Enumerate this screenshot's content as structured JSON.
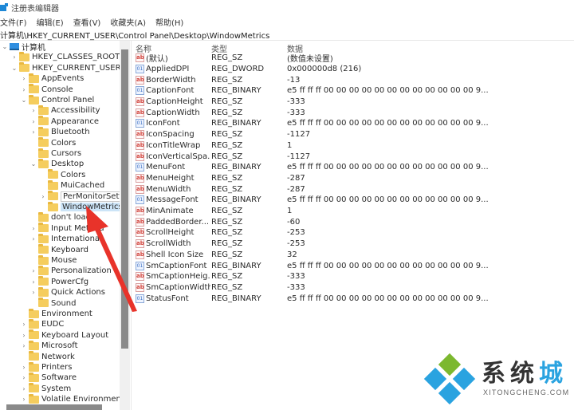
{
  "window": {
    "title": "注册表编辑器",
    "icon": "regedit-icon"
  },
  "menu": [
    "文件(F)",
    "编辑(E)",
    "查看(V)",
    "收藏夹(A)",
    "帮助(H)"
  ],
  "address": "计算机\\HKEY_CURRENT_USER\\Control Panel\\Desktop\\WindowMetrics",
  "tree": [
    {
      "label": "计算机",
      "depth": 0,
      "chevron": "down",
      "icon": "computer-icon"
    },
    {
      "label": "HKEY_CLASSES_ROOT",
      "depth": 1,
      "chevron": "right",
      "icon": "folder-icon"
    },
    {
      "label": "HKEY_CURRENT_USER",
      "depth": 1,
      "chevron": "down",
      "icon": "folder-icon"
    },
    {
      "label": "AppEvents",
      "depth": 2,
      "chevron": "right",
      "icon": "folder-icon"
    },
    {
      "label": "Console",
      "depth": 2,
      "chevron": "right",
      "icon": "folder-icon"
    },
    {
      "label": "Control Panel",
      "depth": 2,
      "chevron": "down",
      "icon": "folder-icon"
    },
    {
      "label": "Accessibility",
      "depth": 3,
      "chevron": "right",
      "icon": "folder-icon"
    },
    {
      "label": "Appearance",
      "depth": 3,
      "chevron": "right",
      "icon": "folder-icon"
    },
    {
      "label": "Bluetooth",
      "depth": 3,
      "chevron": "right",
      "icon": "folder-icon"
    },
    {
      "label": "Colors",
      "depth": 3,
      "chevron": "",
      "icon": "folder-icon"
    },
    {
      "label": "Cursors",
      "depth": 3,
      "chevron": "",
      "icon": "folder-icon"
    },
    {
      "label": "Desktop",
      "depth": 3,
      "chevron": "down",
      "icon": "folder-icon"
    },
    {
      "label": "Colors",
      "depth": 4,
      "chevron": "",
      "icon": "folder-icon"
    },
    {
      "label": "MuiCached",
      "depth": 4,
      "chevron": "",
      "icon": "folder-icon"
    },
    {
      "label": "PerMonitorSettings",
      "depth": 4,
      "chevron": "right",
      "icon": "folder-icon",
      "tooltip": true
    },
    {
      "label": "WindowMetrics",
      "depth": 4,
      "chevron": "",
      "icon": "folder-icon",
      "selected": true
    },
    {
      "label": "don't load",
      "depth": 3,
      "chevron": "",
      "icon": "folder-icon"
    },
    {
      "label": "Input Method",
      "depth": 3,
      "chevron": "right",
      "icon": "folder-icon"
    },
    {
      "label": "International",
      "depth": 3,
      "chevron": "right",
      "icon": "folder-icon"
    },
    {
      "label": "Keyboard",
      "depth": 3,
      "chevron": "",
      "icon": "folder-icon"
    },
    {
      "label": "Mouse",
      "depth": 3,
      "chevron": "",
      "icon": "folder-icon"
    },
    {
      "label": "Personalization",
      "depth": 3,
      "chevron": "right",
      "icon": "folder-icon"
    },
    {
      "label": "PowerCfg",
      "depth": 3,
      "chevron": "right",
      "icon": "folder-icon"
    },
    {
      "label": "Quick Actions",
      "depth": 3,
      "chevron": "right",
      "icon": "folder-icon"
    },
    {
      "label": "Sound",
      "depth": 3,
      "chevron": "",
      "icon": "folder-icon"
    },
    {
      "label": "Environment",
      "depth": 2,
      "chevron": "",
      "icon": "folder-icon"
    },
    {
      "label": "EUDC",
      "depth": 2,
      "chevron": "right",
      "icon": "folder-icon"
    },
    {
      "label": "Keyboard Layout",
      "depth": 2,
      "chevron": "right",
      "icon": "folder-icon"
    },
    {
      "label": "Microsoft",
      "depth": 2,
      "chevron": "right",
      "icon": "folder-icon"
    },
    {
      "label": "Network",
      "depth": 2,
      "chevron": "",
      "icon": "folder-icon"
    },
    {
      "label": "Printers",
      "depth": 2,
      "chevron": "right",
      "icon": "folder-icon"
    },
    {
      "label": "Software",
      "depth": 2,
      "chevron": "right",
      "icon": "folder-icon"
    },
    {
      "label": "System",
      "depth": 2,
      "chevron": "right",
      "icon": "folder-icon"
    },
    {
      "label": "Volatile Environment",
      "depth": 2,
      "chevron": "right",
      "icon": "folder-icon"
    }
  ],
  "list": {
    "headers": {
      "name": "名称",
      "type": "类型",
      "data": "数据"
    },
    "rows": [
      {
        "name": "(默认)",
        "type": "REG_SZ",
        "data": "(数值未设置)",
        "icon": "string-value-icon"
      },
      {
        "name": "AppliedDPI",
        "type": "REG_DWORD",
        "data": "0x000000d8 (216)",
        "icon": "binary-value-icon"
      },
      {
        "name": "BorderWidth",
        "type": "REG_SZ",
        "data": "-13",
        "icon": "string-value-icon"
      },
      {
        "name": "CaptionFont",
        "type": "REG_BINARY",
        "data": "e5 ff ff ff 00 00 00 00 00 00 00 00 00 00 00 00 9...",
        "icon": "binary-value-icon"
      },
      {
        "name": "CaptionHeight",
        "type": "REG_SZ",
        "data": "-333",
        "icon": "string-value-icon"
      },
      {
        "name": "CaptionWidth",
        "type": "REG_SZ",
        "data": "-333",
        "icon": "string-value-icon"
      },
      {
        "name": "IconFont",
        "type": "REG_BINARY",
        "data": "e5 ff ff ff 00 00 00 00 00 00 00 00 00 00 00 00 9...",
        "icon": "binary-value-icon"
      },
      {
        "name": "IconSpacing",
        "type": "REG_SZ",
        "data": "-1127",
        "icon": "string-value-icon"
      },
      {
        "name": "IconTitleWrap",
        "type": "REG_SZ",
        "data": "1",
        "icon": "string-value-icon"
      },
      {
        "name": "IconVerticalSpa...",
        "type": "REG_SZ",
        "data": "-1127",
        "icon": "string-value-icon"
      },
      {
        "name": "MenuFont",
        "type": "REG_BINARY",
        "data": "e5 ff ff ff 00 00 00 00 00 00 00 00 00 00 00 00 9...",
        "icon": "binary-value-icon"
      },
      {
        "name": "MenuHeight",
        "type": "REG_SZ",
        "data": "-287",
        "icon": "string-value-icon"
      },
      {
        "name": "MenuWidth",
        "type": "REG_SZ",
        "data": "-287",
        "icon": "string-value-icon"
      },
      {
        "name": "MessageFont",
        "type": "REG_BINARY",
        "data": "e5 ff ff ff 00 00 00 00 00 00 00 00 00 00 00 00 9...",
        "icon": "binary-value-icon"
      },
      {
        "name": "MinAnimate",
        "type": "REG_SZ",
        "data": "1",
        "icon": "string-value-icon"
      },
      {
        "name": "PaddedBorder...",
        "type": "REG_SZ",
        "data": "-60",
        "icon": "string-value-icon"
      },
      {
        "name": "ScrollHeight",
        "type": "REG_SZ",
        "data": "-253",
        "icon": "string-value-icon"
      },
      {
        "name": "ScrollWidth",
        "type": "REG_SZ",
        "data": "-253",
        "icon": "string-value-icon"
      },
      {
        "name": "Shell Icon Size",
        "type": "REG_SZ",
        "data": "32",
        "icon": "string-value-icon"
      },
      {
        "name": "SmCaptionFont",
        "type": "REG_BINARY",
        "data": "e5 ff ff ff 00 00 00 00 00 00 00 00 00 00 00 00 9...",
        "icon": "binary-value-icon"
      },
      {
        "name": "SmCaptionHeig...",
        "type": "REG_SZ",
        "data": "-333",
        "icon": "string-value-icon"
      },
      {
        "name": "SmCaptionWidth",
        "type": "REG_SZ",
        "data": "-333",
        "icon": "string-value-icon"
      },
      {
        "name": "StatusFont",
        "type": "REG_BINARY",
        "data": "e5 ff ff ff 00 00 00 00 00 00 00 00 00 00 00 00 9...",
        "icon": "binary-value-icon"
      }
    ]
  },
  "watermark": {
    "brand_a": "系统",
    "brand_b": "城",
    "url": "XITONGCHENG.COM",
    "colors": {
      "green": "#7cb82f",
      "blue": "#2aa3e0"
    }
  },
  "annotation": {
    "type": "red-arrow",
    "color": "#e8332a",
    "points_to": "WindowMetrics"
  }
}
